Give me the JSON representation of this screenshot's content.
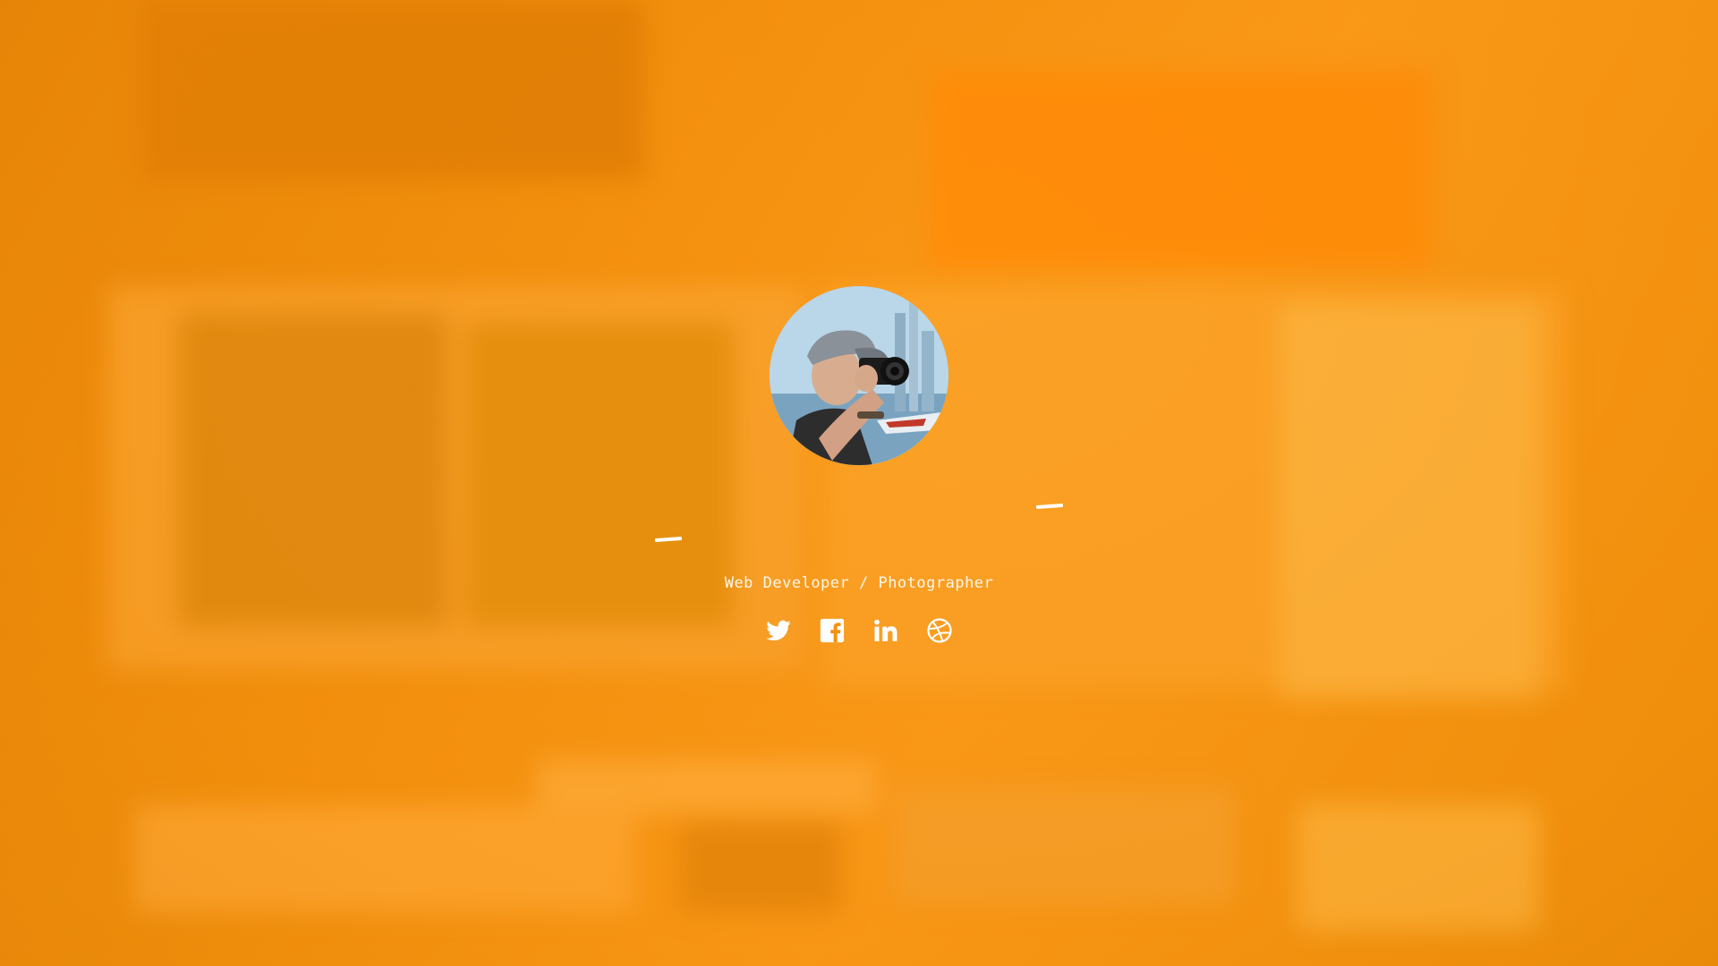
{
  "profile": {
    "tagline": "Web Developer / Photographer",
    "avatar_icon": "photographer-avatar"
  },
  "social": [
    {
      "name": "twitter",
      "icon": "twitter-icon"
    },
    {
      "name": "facebook",
      "icon": "facebook-icon"
    },
    {
      "name": "linkedin",
      "icon": "linkedin-icon"
    },
    {
      "name": "dribbble",
      "icon": "dribbble-icon"
    }
  ],
  "colors": {
    "accent": "#f5920f",
    "text": "#ffffff"
  }
}
